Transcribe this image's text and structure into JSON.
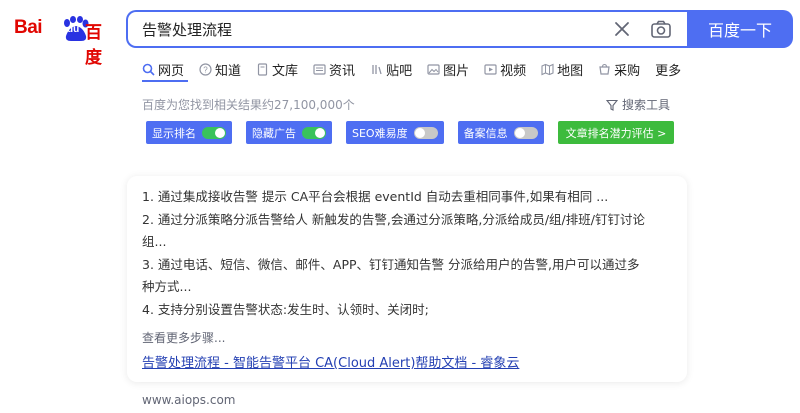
{
  "logo": {
    "bai": "Bai",
    "du": "du",
    "cn": "百度"
  },
  "search": {
    "query": "告警处理流程",
    "button_label": "百度一下"
  },
  "tabs": [
    {
      "label": "网页",
      "icon": "search-icon"
    },
    {
      "label": "知道",
      "icon": "question-icon"
    },
    {
      "label": "文库",
      "icon": "document-icon"
    },
    {
      "label": "资讯",
      "icon": "news-icon"
    },
    {
      "label": "贴吧",
      "icon": "tieba-icon"
    },
    {
      "label": "图片",
      "icon": "image-icon"
    },
    {
      "label": "视频",
      "icon": "video-icon"
    },
    {
      "label": "地图",
      "icon": "map-icon"
    },
    {
      "label": "采购",
      "icon": "purchase-icon"
    },
    {
      "label": "更多",
      "icon": ""
    }
  ],
  "result_count": "百度为您找到相关结果约27,100,000个",
  "search_tools": "搜索工具",
  "toggles": [
    {
      "label": "显示排名",
      "state": "on"
    },
    {
      "label": "隐藏广告",
      "state": "on"
    },
    {
      "label": "SEO难易度",
      "state": "off"
    },
    {
      "label": "备案信息",
      "state": "off"
    }
  ],
  "rank_eval_button": "文章排名潜力评估 >",
  "result": {
    "lines": [
      "1. 通过集成接收告警 提示 CA平台会根据 eventId 自动去重相同事件,如果有相同 ...",
      "2. 通过分派策略分派告警给人 新触发的告警,会通过分派策略,分派给成员/组/排班/钉钉讨论",
      "组...",
      "3. 通过电话、短信、微信、邮件、APP、钉钉通知告警 分派给用户的告警,用户可以通过多",
      "种方式...",
      "4. 支持分别设置告警状态:发生时、认领时、关闭时;"
    ],
    "see_more": "查看更多步骤...",
    "link_title": "告警处理流程 - 智能告警平台 CA(Cloud Alert)帮助文档 - 睿象云",
    "site": "www.aiops.com"
  },
  "colors": {
    "brand_blue": "#4e6ef2",
    "baidu_red": "#e10601",
    "link_blue": "#2440b3",
    "switch_on": "#39c25c",
    "green_button": "#3dbb3d"
  }
}
